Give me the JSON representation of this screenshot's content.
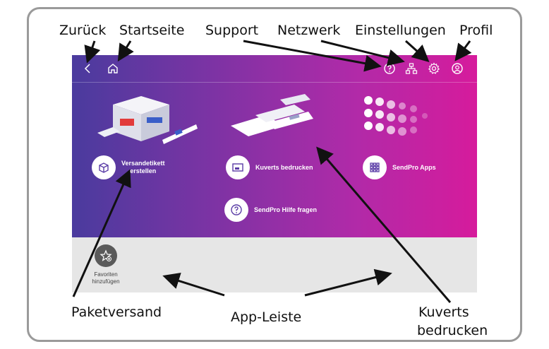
{
  "callouts": {
    "back": "Zurück",
    "home": "Startseite",
    "support": "Support",
    "network": "Netzwerk",
    "settings": "Einstellungen",
    "profile": "Profil",
    "parcel": "Paketversand",
    "app_bar": "App-Leiste",
    "envelopes_line1": "Kuverts",
    "envelopes_line2": "bedrucken"
  },
  "tiles": {
    "shipping_label_line1": "Versandetikett",
    "shipping_label_line2": "erstellen",
    "print_envelopes": "Kuverts bedrucken",
    "sendpro_apps": "SendPro Apps",
    "help": "SendPro Hilfe fragen"
  },
  "app_bar": {
    "favorites_line1": "Favoriten",
    "favorites_line2": "hinzufügen"
  },
  "icons": {
    "back": "back-arrow-icon",
    "home": "home-icon",
    "support": "question-icon",
    "network": "network-icon",
    "settings": "gear-icon",
    "profile": "user-icon"
  },
  "colors": {
    "gradient_start": "#4a3b9e",
    "gradient_end": "#d61b9c",
    "app_bar_bg": "#e6e6e6"
  }
}
